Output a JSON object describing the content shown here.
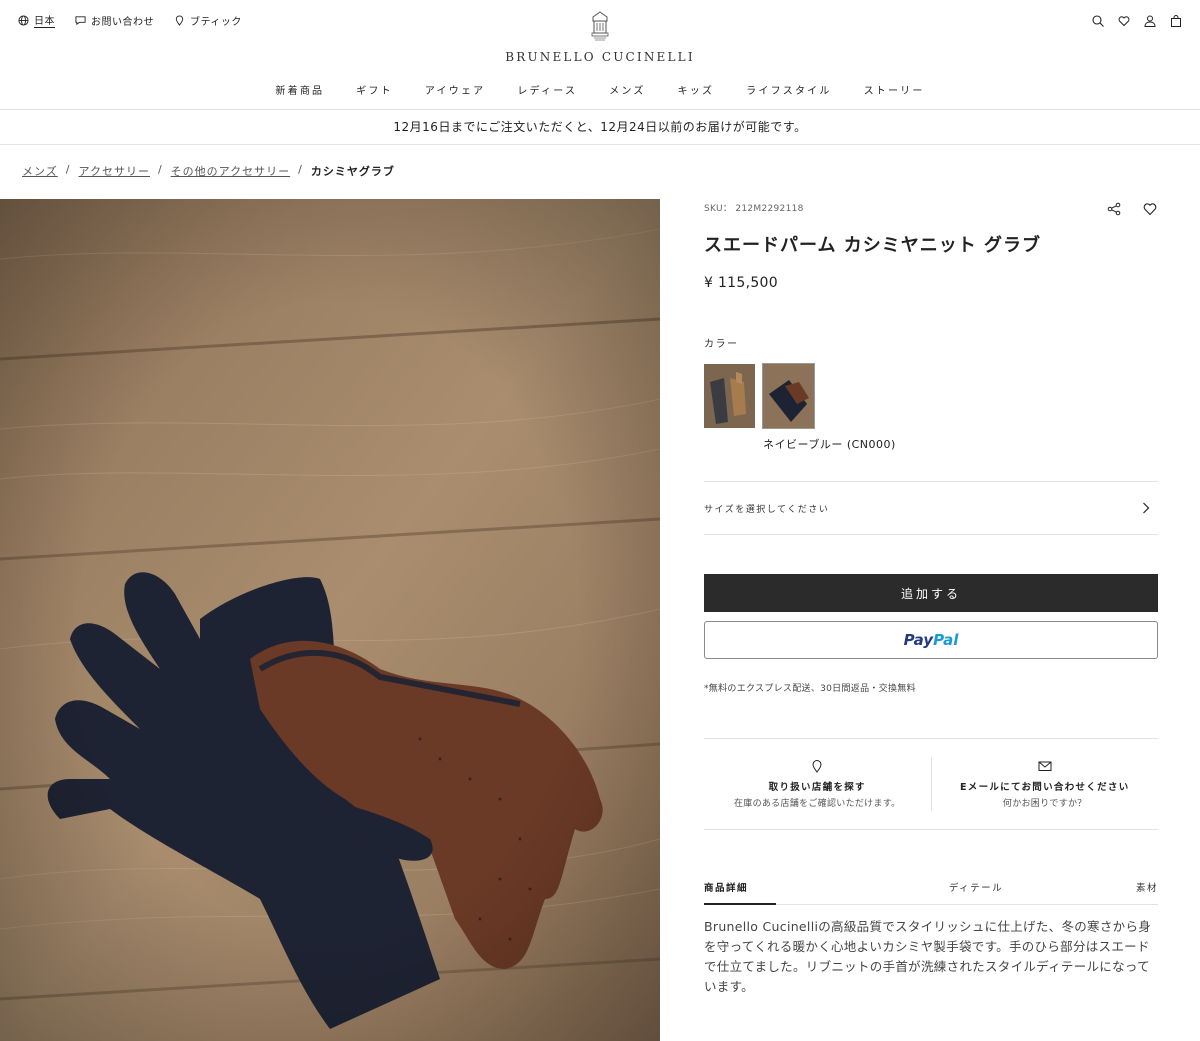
{
  "header": {
    "util": [
      {
        "label": "日本",
        "icon": "globe-icon"
      },
      {
        "label": "お問い合わせ",
        "icon": "chat-icon"
      },
      {
        "label": "ブティック",
        "icon": "location-pin-icon"
      }
    ],
    "logo_text": "BRUNELLO CUCINELLI",
    "nav": [
      "新着商品",
      "ギフト",
      "アイウェア",
      "レディース",
      "メンズ",
      "キッズ",
      "ライフスタイル",
      "ストーリー"
    ]
  },
  "banner": "12月16日までにご注文いただくと、12月24日以前のお届けが可能です。",
  "breadcrumb": [
    "メンズ",
    "アクセサリー",
    "その他のアクセサリー",
    "カシミヤグラブ"
  ],
  "product": {
    "sku": "SKU： 212M2292118",
    "title": "スエードパーム カシミヤニット グラブ",
    "price": "¥ 115,500",
    "color_label": "カラー",
    "color_name": "ネイビーブルー (CN000)",
    "size_prompt": "サイズを選択してください",
    "add_to_cart": "追加する",
    "paypal_a": "Pay",
    "paypal_b": "Pal",
    "note": "*無料のエクスプレス配送、30日間返品・交換無料",
    "services": [
      {
        "title": "取り扱い店舗を探す",
        "sub": "在庫のある店舗をご確認いただけます。"
      },
      {
        "title": "Eメールにてお問い合わせください",
        "sub": "何かお困りですか？"
      }
    ],
    "tabs": [
      "商品詳細",
      "ディテール",
      "素材"
    ],
    "description": "Brunello Cucinelliの高級品質でスタイリッシュに仕上げた、冬の寒さから身を守ってくれる暖かく心地よいカシミヤ製手袋です。手のひら部分はスエードで仕立てました。リブニットの手首が洗練されたスタイルディテールになっています。"
  },
  "colors": {
    "wood": "#a68a6c",
    "navy": "#1e2333",
    "suede": "#6b3a26",
    "button": "#2b2b2b"
  }
}
